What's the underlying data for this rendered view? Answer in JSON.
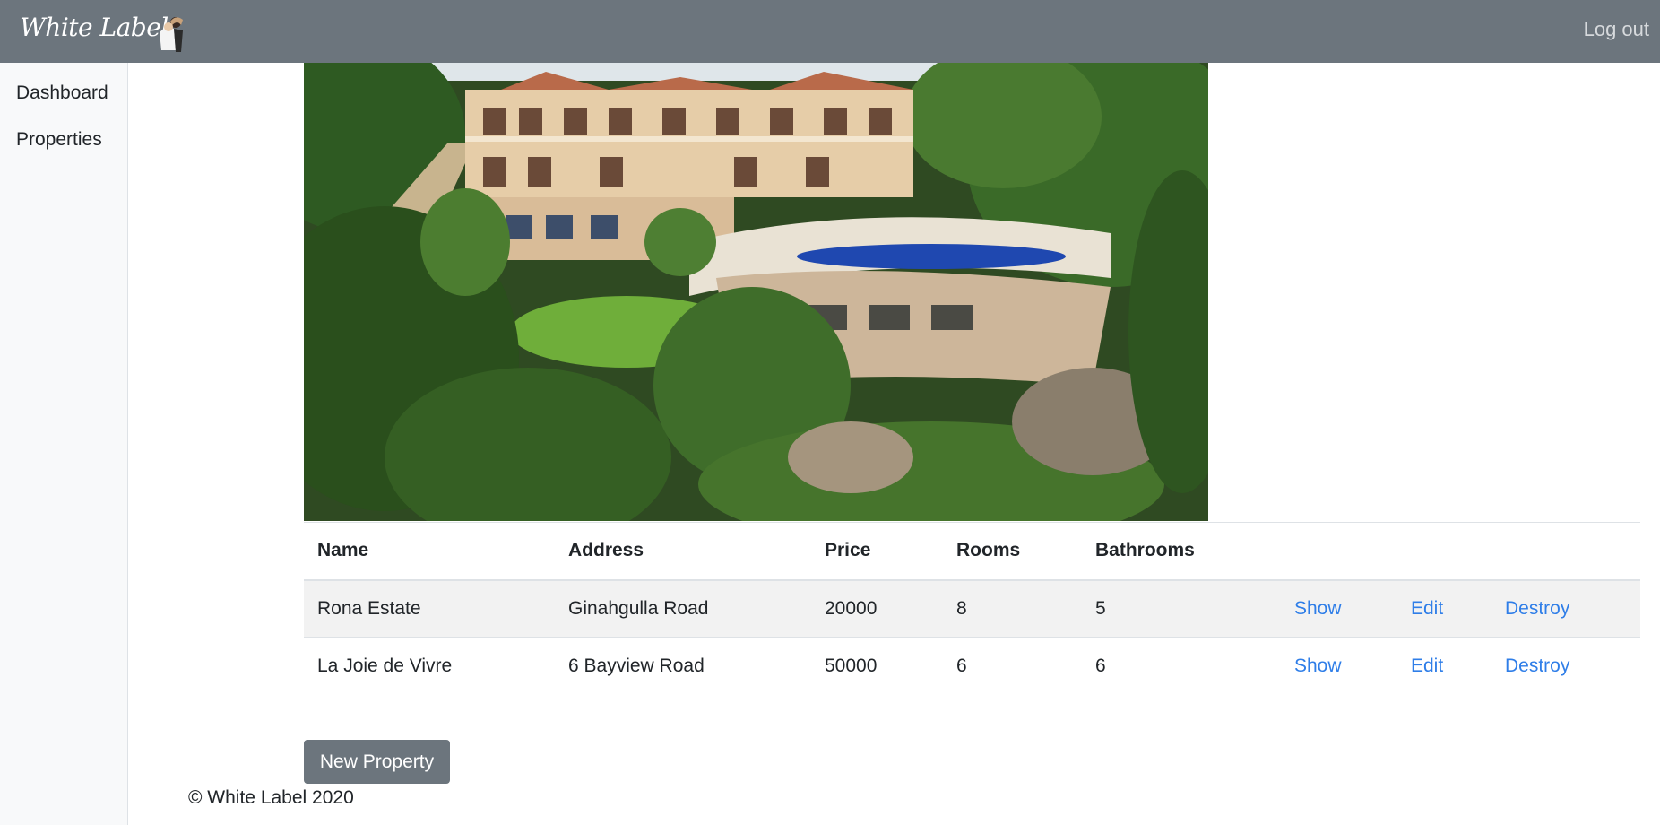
{
  "navbar": {
    "brand": "White Label",
    "logout_label": "Log out",
    "bg_color": "#6c757d"
  },
  "sidebar": {
    "items": [
      {
        "label": "Dashboard"
      },
      {
        "label": "Properties"
      }
    ]
  },
  "hero": {
    "icon": "mansion-photo"
  },
  "table": {
    "headers": [
      "Name",
      "Address",
      "Price",
      "Rooms",
      "Bathrooms"
    ],
    "rows": [
      {
        "name": "Rona Estate",
        "address": "Ginahgulla Road",
        "price": "20000",
        "rooms": "8",
        "bathrooms": "5",
        "show": "Show",
        "edit": "Edit",
        "destroy": "Destroy"
      },
      {
        "name": "La Joie de Vivre",
        "address": "6 Bayview Road",
        "price": "50000",
        "rooms": "6",
        "bathrooms": "6",
        "show": "Show",
        "edit": "Edit",
        "destroy": "Destroy"
      }
    ]
  },
  "actions": {
    "new_property_label": "New Property"
  },
  "footer": {
    "text": "© White Label 2020"
  },
  "colors": {
    "link": "#2f7ee8",
    "button": "#6c757d",
    "stripe": "#f2f2f2"
  }
}
